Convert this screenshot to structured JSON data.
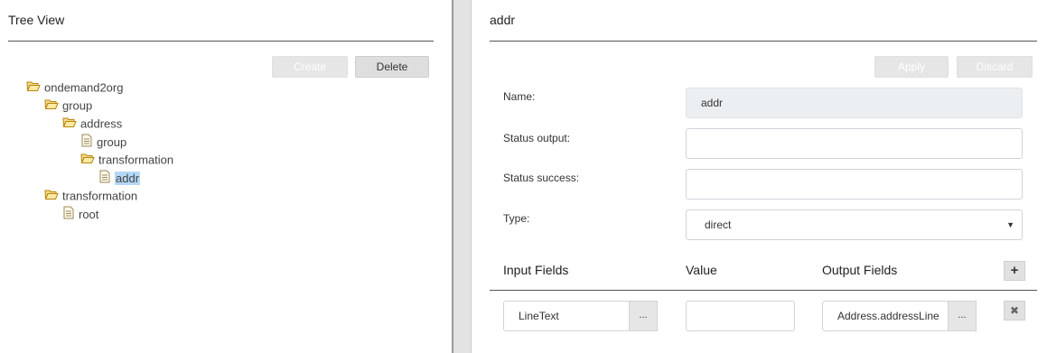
{
  "tree_panel": {
    "title": "Tree View",
    "create_label": "Create",
    "delete_label": "Delete",
    "nodes": [
      {
        "label": "ondemand2org",
        "type": "folder"
      },
      {
        "label": "group",
        "type": "folder"
      },
      {
        "label": "address",
        "type": "folder"
      },
      {
        "label": "group",
        "type": "file"
      },
      {
        "label": "transformation",
        "type": "folder"
      },
      {
        "label": "addr",
        "type": "file",
        "selected": true
      },
      {
        "label": "transformation",
        "type": "folder"
      },
      {
        "label": "root",
        "type": "file"
      }
    ]
  },
  "detail_panel": {
    "title": "addr",
    "apply_label": "Apply",
    "discard_label": "Discard",
    "name_label": "Name:",
    "name_value": "addr",
    "status_output_label": "Status output:",
    "status_output_value": "",
    "status_success_label": "Status success:",
    "status_success_value": "",
    "type_label": "Type:",
    "type_value": "direct",
    "columns": {
      "input": "Input Fields",
      "value": "Value",
      "output": "Output Fields"
    },
    "add_label": "+",
    "rows": [
      {
        "input": "LineText",
        "input_more": "...",
        "value": "",
        "output": "Address.addressLine",
        "output_more": "...",
        "remove_label": "✖"
      }
    ]
  }
}
